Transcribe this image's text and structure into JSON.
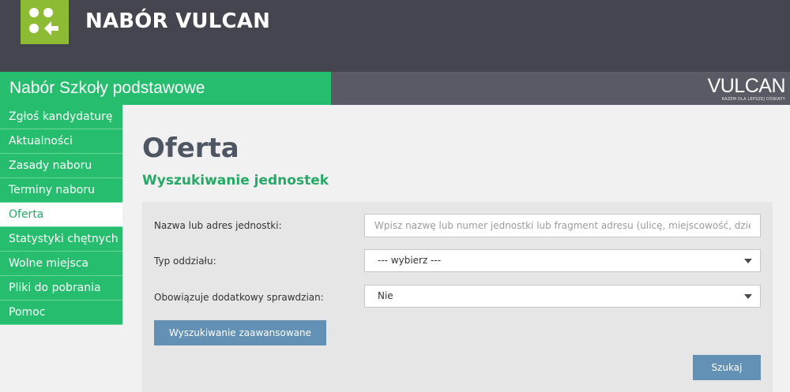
{
  "header": {
    "app_title": "NABÓR VULCAN",
    "logo_icon": "dots-arrow-logo-icon",
    "logo_color": "#8dbb33",
    "bar_color": "#45454f"
  },
  "strip": {
    "title": "Nabór Szkoły podstawowe",
    "brand": "VULCAN",
    "brand_tagline": "RAZEM DLA LEPSZEJ OŚWIATY",
    "accent_color": "#26be6e"
  },
  "sidebar": {
    "items": [
      {
        "label": "Zgłoś kandydaturę"
      },
      {
        "label": "Aktualności"
      },
      {
        "label": "Zasady naboru"
      },
      {
        "label": "Terminy naboru"
      },
      {
        "label": "Oferta",
        "active": true
      },
      {
        "label": "Statystyki chętnych"
      },
      {
        "label": "Wolne miejsca"
      },
      {
        "label": "Pliki do pobrania"
      },
      {
        "label": "Pomoc"
      }
    ]
  },
  "main": {
    "page_title": "Oferta",
    "section_title": "Wyszukiwanie jednostek",
    "form": {
      "name_label": "Nazwa lub adres jednostki:",
      "name_value": "",
      "name_placeholder": "Wpisz nazwę lub numer jednostki lub fragment adresu (ulicę, miejscowość, dzielnicę)",
      "type_label": "Typ oddziału:",
      "type_value": "--- wybierz ---",
      "exam_label": "Obowiązuje dodatkowy sprawdzian:",
      "exam_value": "Nie",
      "advanced_button": "Wyszukiwanie zaawansowane",
      "search_button": "Szukaj",
      "button_color": "#6391b5"
    }
  }
}
